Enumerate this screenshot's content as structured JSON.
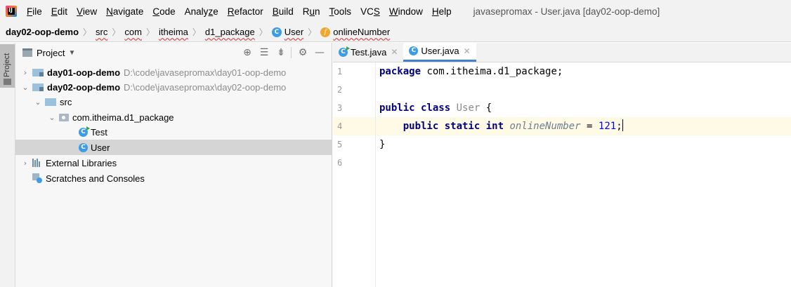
{
  "menubar": {
    "items": [
      {
        "label": "File",
        "u": "F"
      },
      {
        "label": "Edit",
        "u": "E"
      },
      {
        "label": "View",
        "u": "V"
      },
      {
        "label": "Navigate",
        "u": "N"
      },
      {
        "label": "Code",
        "u": "C"
      },
      {
        "label": "Analyze",
        "u": "z"
      },
      {
        "label": "Refactor",
        "u": "R"
      },
      {
        "label": "Build",
        "u": "B"
      },
      {
        "label": "Run",
        "u": "u"
      },
      {
        "label": "Tools",
        "u": "T"
      },
      {
        "label": "VCS",
        "u": "S"
      },
      {
        "label": "Window",
        "u": "W"
      },
      {
        "label": "Help",
        "u": "H"
      }
    ],
    "window_title": "javasepromax - User.java [day02-oop-demo]"
  },
  "breadcrumb": {
    "project": "day02-oop-demo",
    "items": [
      "src",
      "com",
      "itheima",
      "d1_package",
      "User"
    ],
    "member": "onlineNumber"
  },
  "tool_stripe": {
    "project_label": "Project"
  },
  "project_panel": {
    "title": "Project",
    "tree": [
      {
        "label": "day01-oop-demo",
        "hint": "D:\\code\\javasepromax\\day01-oop-demo"
      },
      {
        "label": "day02-oop-demo",
        "hint": "D:\\code\\javasepromax\\day02-oop-demo"
      },
      {
        "label": "src"
      },
      {
        "label": "com.itheima.d1_package"
      },
      {
        "label": "Test"
      },
      {
        "label": "User"
      },
      {
        "label": "External Libraries"
      },
      {
        "label": "Scratches and Consoles"
      }
    ]
  },
  "editor": {
    "tabs": [
      {
        "label": "Test.java"
      },
      {
        "label": "User.java"
      }
    ],
    "line_numbers": [
      "1",
      "2",
      "3",
      "4",
      "5",
      "6"
    ],
    "code": {
      "l1_kw": "package",
      "l1_rest": " com.itheima.d1_package;",
      "l3_kw": "public class",
      "l3_cls": "User",
      "l3_rest": " {",
      "l4_kw": "public static int",
      "l4_field": "onlineNumber",
      "l4_eq": " = ",
      "l4_num": "121",
      "l4_end": ";",
      "l5": "}"
    }
  },
  "colors": {
    "keyword": "#000080",
    "number": "#0000ff",
    "current_line": "#fefae6",
    "accent_tab": "#4083c9",
    "selected_row": "#d5d5d5"
  }
}
